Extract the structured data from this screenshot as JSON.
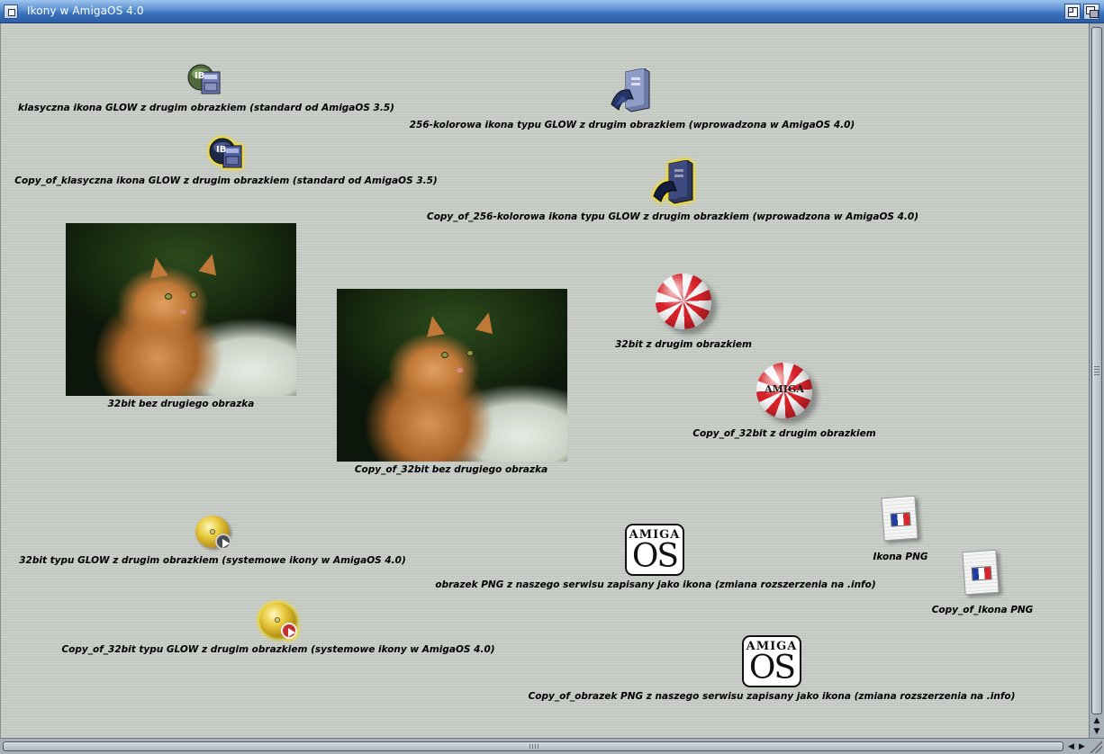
{
  "window": {
    "title": "Ikony w AmigaOS 4.0"
  },
  "icons": [
    {
      "label": "klasyczna ikona GLOW z drugim obrazkiem (standard od AmigaOS 3.5)",
      "image": "ib-disk-icon"
    },
    {
      "label": "Copy_of_klasyczna ikona GLOW z drugim obrazkiem (standard od AmigaOS 3.5)",
      "image": "ib-disk-icon"
    },
    {
      "label": "256-kolorowa ikona typu GLOW z drugim obrazkiem (wprowadzona w AmigaOS 4.0)",
      "image": "server-icon"
    },
    {
      "label": "Copy_of_256-kolorowa ikona typu GLOW z drugim obrazkiem (wprowadzona w AmigaOS 4.0)",
      "image": "server-icon"
    },
    {
      "label": "32bit bez drugiego obrazka",
      "image": "cat-photo"
    },
    {
      "label": "Copy_of_32bit bez drugiego obrazka",
      "image": "cat-photo"
    },
    {
      "label": "32bit z drugim obrazkiem",
      "image": "amiga-ball-icon"
    },
    {
      "label": "Copy_of_32bit z drugim obrazkiem",
      "image": "amiga-ball-icon",
      "ball_text": "AMIGA"
    },
    {
      "label": "32bit typu GLOW z drugim obrazkiem (systemowe ikony w AmigaOS 4.0)",
      "image": "cd-disc-icon"
    },
    {
      "label": "Copy_of_32bit typu GLOW z drugim obrazkiem (systemowe ikony w AmigaOS 4.0)",
      "image": "cd-disc-icon"
    },
    {
      "label": "obrazek PNG z naszego serwisu zapisany jako ikona (zmiana rozszerzenia na .info)",
      "image": "amiga-os-logo",
      "logo_top": "AMIGA",
      "logo_bottom": "OS"
    },
    {
      "label": "Copy_of_obrazek PNG z naszego serwisu zapisany jako ikona (zmiana rozszerzenia na .info)",
      "image": "amiga-os-logo",
      "logo_top": "AMIGA",
      "logo_bottom": "OS"
    },
    {
      "label": "Ikona PNG",
      "image": "french-flag-document-icon"
    },
    {
      "label": "Copy_of_Ikona PNG",
      "image": "french-flag-document-icon"
    }
  ],
  "scrollbars": {
    "up_arrow": "▲",
    "down_arrow": "▼",
    "left_arrow": "◀",
    "right_arrow": "▶"
  }
}
